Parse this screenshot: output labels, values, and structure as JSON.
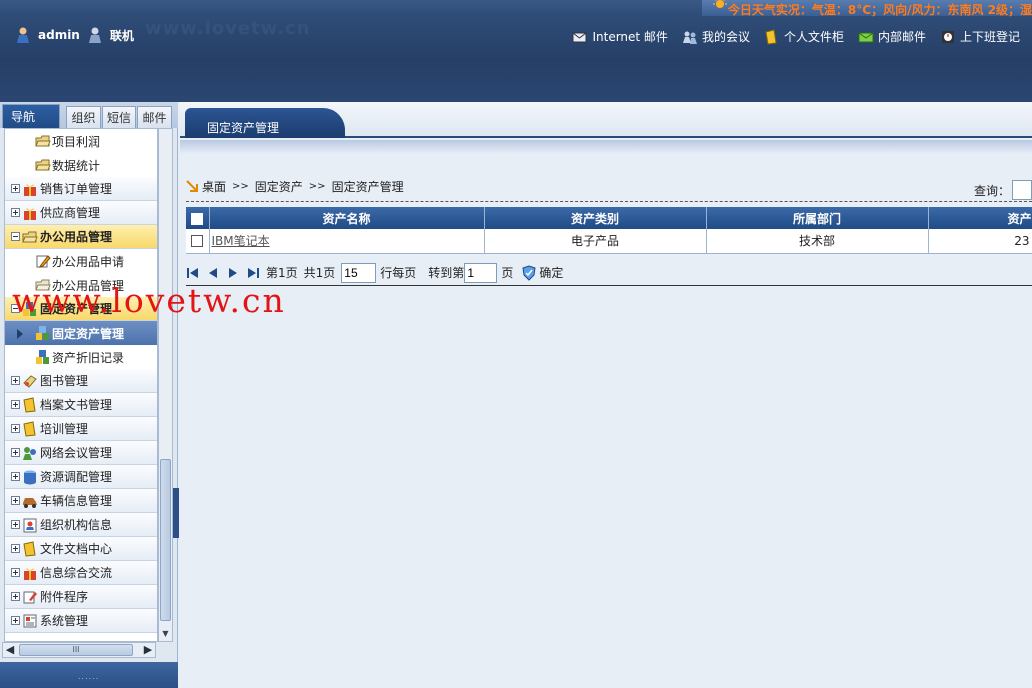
{
  "header": {
    "weather": "今日天气实况：气温：8°C；风向/风力：东南风 2级；湿",
    "watermark_faded": "www.lovetw.cn",
    "user": "admin",
    "status": "联机",
    "links": [
      {
        "label": "Internet 邮件",
        "icon": "mail-icon"
      },
      {
        "label": "我的会议",
        "icon": "meeting-icon"
      },
      {
        "label": "个人文件柜",
        "icon": "folder-icon"
      },
      {
        "label": "内部邮件",
        "icon": "envelope-icon"
      },
      {
        "label": "上下班登记",
        "icon": "attendance-icon"
      }
    ]
  },
  "sidebar": {
    "tabs": {
      "nav": "导航",
      "org": "组织",
      "sms": "短信",
      "mail": "邮件"
    },
    "items": [
      {
        "label": "项目利润",
        "type": "sub"
      },
      {
        "label": "数据统计",
        "type": "sub"
      },
      {
        "label": "销售订单管理",
        "type": "group"
      },
      {
        "label": "供应商管理",
        "type": "group"
      },
      {
        "label": "办公用品管理",
        "type": "group-open"
      },
      {
        "label": "办公用品申请",
        "type": "sub"
      },
      {
        "label": "办公用品管理",
        "type": "sub"
      },
      {
        "label": "固定资产管理",
        "type": "group-open"
      },
      {
        "label": "固定资产管理",
        "type": "sub-selected"
      },
      {
        "label": "资产折旧记录",
        "type": "sub"
      },
      {
        "label": "图书管理",
        "type": "group"
      },
      {
        "label": "档案文书管理",
        "type": "group"
      },
      {
        "label": "培训管理",
        "type": "group"
      },
      {
        "label": "网络会议管理",
        "type": "group"
      },
      {
        "label": "资源调配管理",
        "type": "group"
      },
      {
        "label": "车辆信息管理",
        "type": "group"
      },
      {
        "label": "组织机构信息",
        "type": "group"
      },
      {
        "label": "文件文档中心",
        "type": "group"
      },
      {
        "label": "信息综合交流",
        "type": "group"
      },
      {
        "label": "附件程序",
        "type": "group"
      },
      {
        "label": "系统管理",
        "type": "group"
      }
    ],
    "hscroll_thumb": "III",
    "footer_grip": "......"
  },
  "main": {
    "tab_title": "固定资产管理",
    "breadcrumb": {
      "home": "桌面",
      "sep": ">>",
      "level1": "固定资产",
      "level2": "固定资产管理"
    },
    "search_label": "查询：",
    "table": {
      "columns": [
        "资产名称",
        "资产类别",
        "所属部门",
        "资产"
      ],
      "rows": [
        {
          "name": "IBM笔记本",
          "category": "电子产品",
          "dept": "技术部",
          "amount": "23"
        }
      ]
    },
    "pager": {
      "page_info": "第1页",
      "total_info": "共1页",
      "page_size": "15",
      "per_page_label": "行每页",
      "goto_label": "转到第",
      "goto_value": "1",
      "page_unit": "页",
      "confirm": "确定"
    }
  },
  "watermark": "www.lovetw.cn"
}
